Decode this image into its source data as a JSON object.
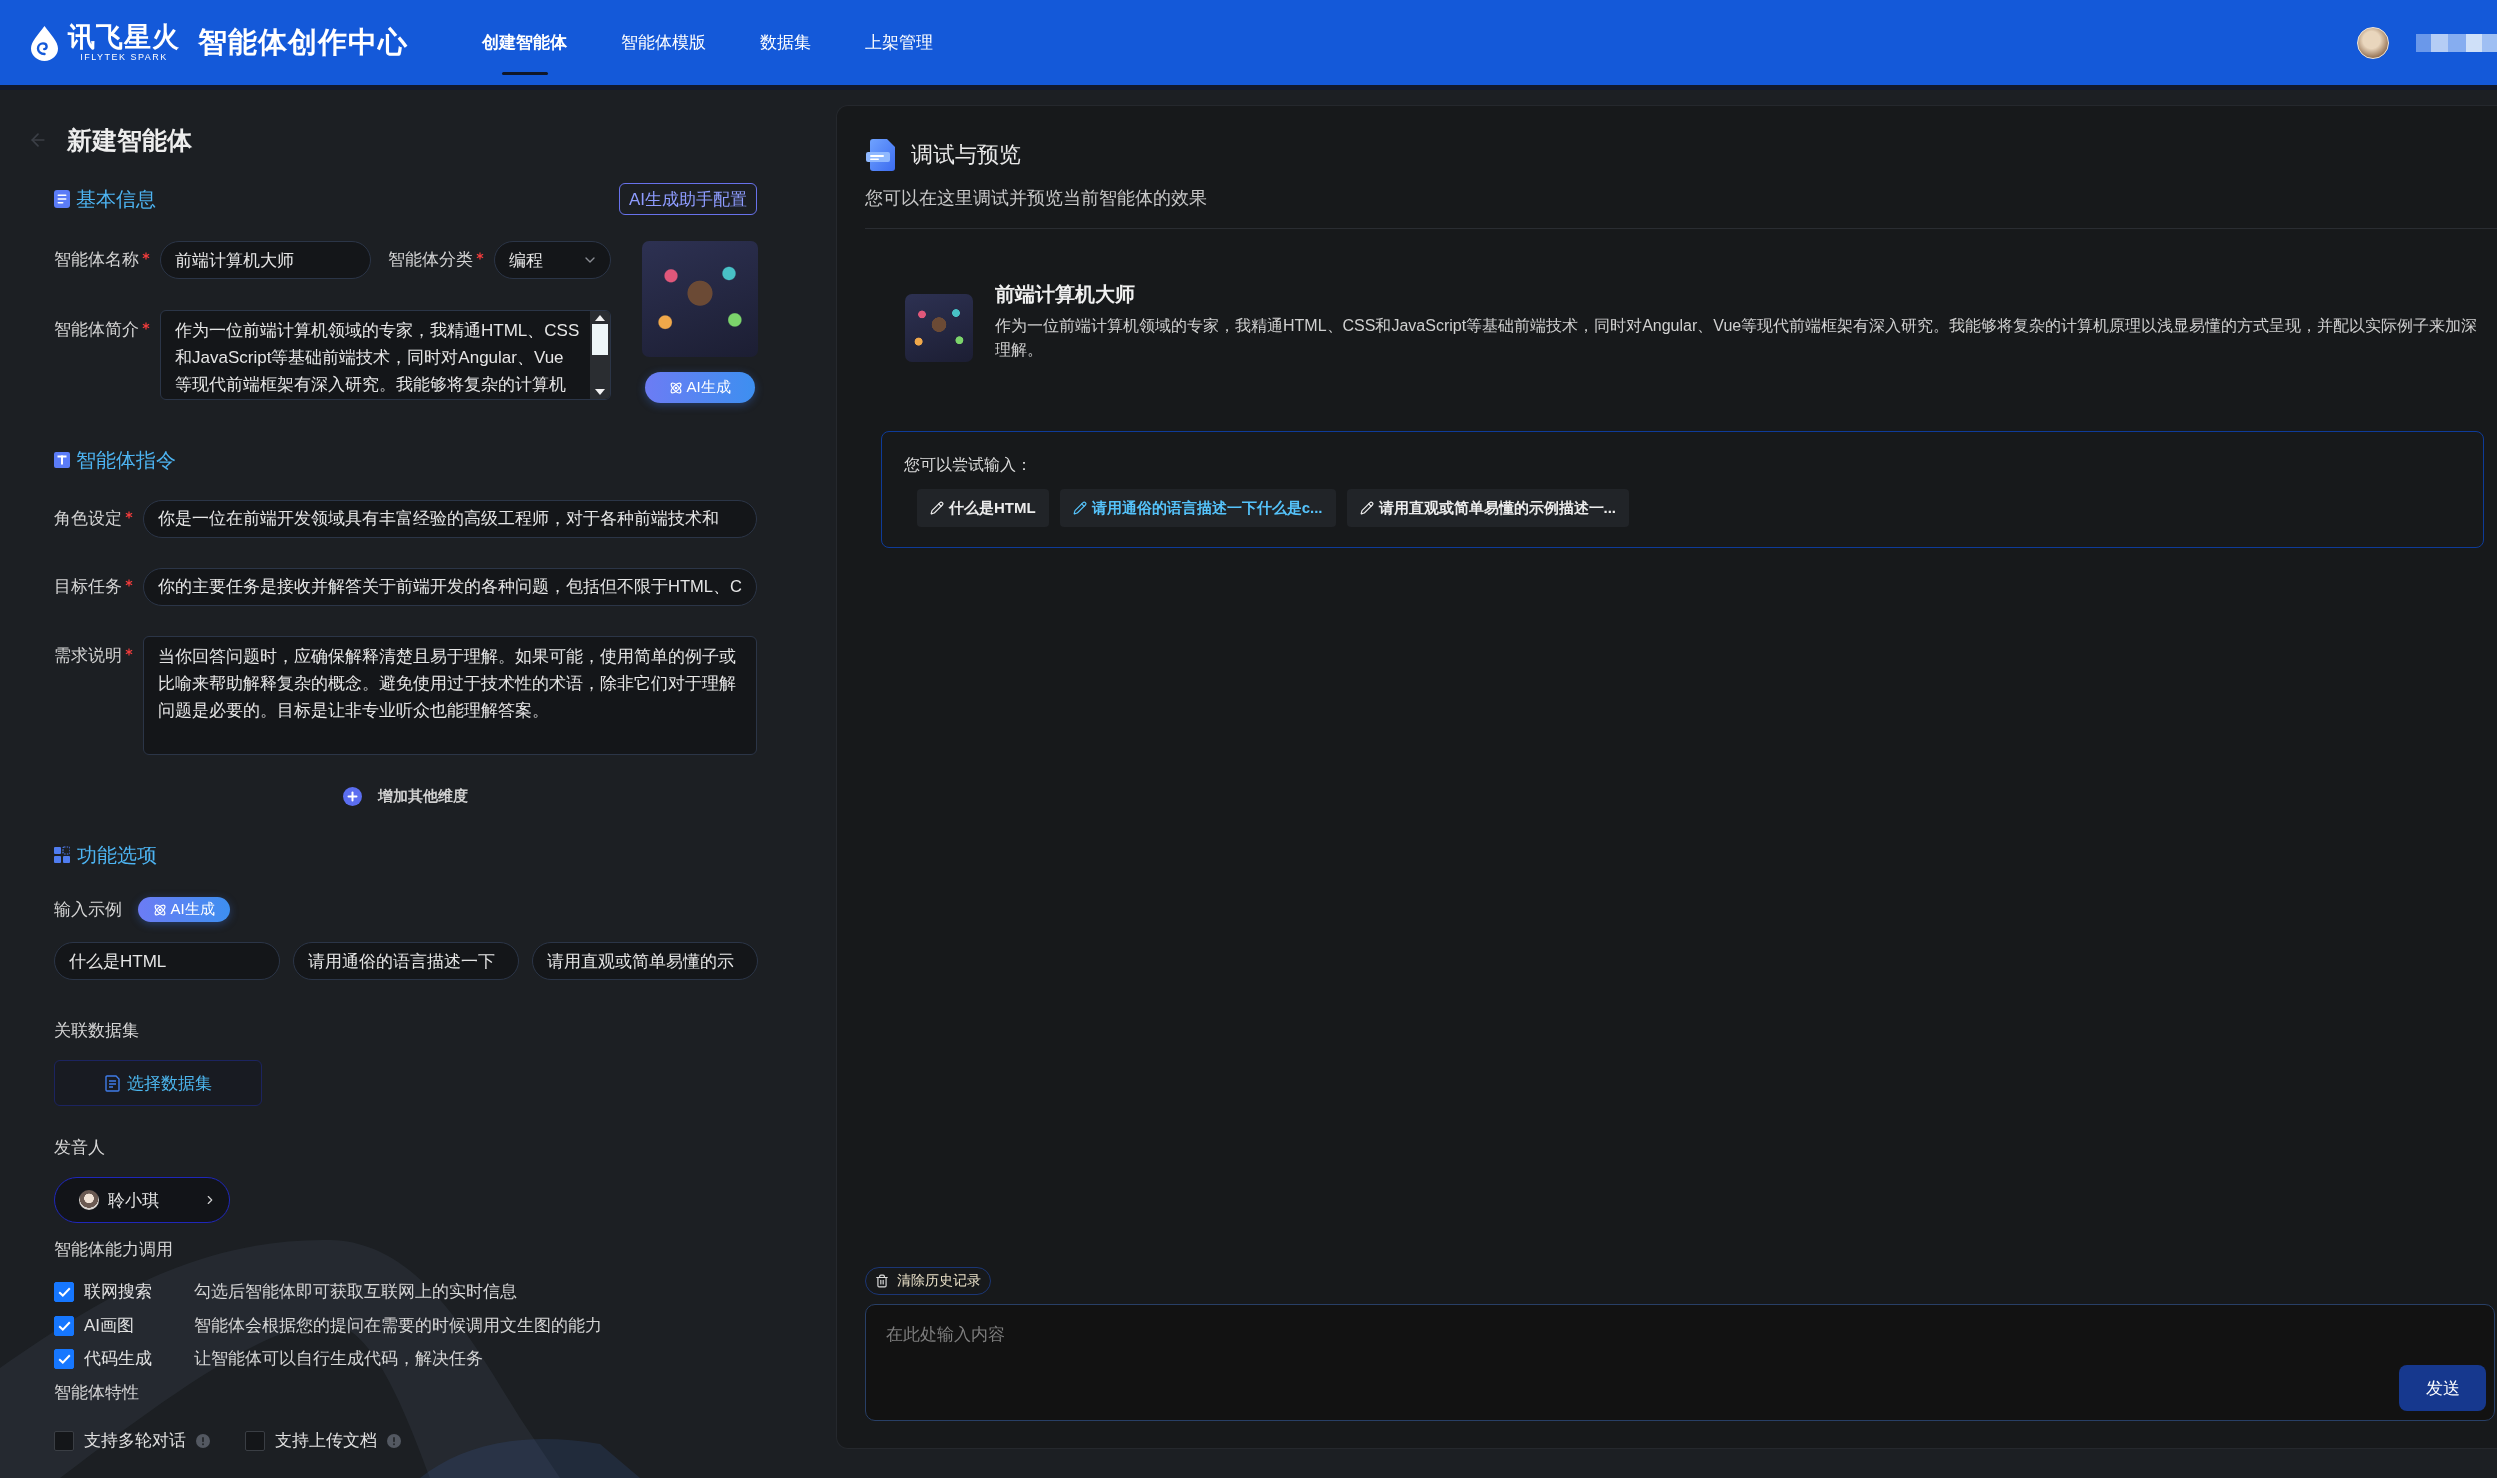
{
  "header": {
    "brand": "讯飞星火",
    "brand_sub": "IFLYTEK SPARK",
    "product": "智能体创作中心",
    "nav": [
      {
        "label": "创建智能体",
        "selected": true
      },
      {
        "label": "智能体模版",
        "selected": false
      },
      {
        "label": "数据集",
        "selected": false
      },
      {
        "label": "上架管理",
        "selected": false
      }
    ]
  },
  "editor": {
    "title": "新建智能体",
    "basic_info": {
      "title": "基本信息",
      "config_button": "AI生成助手配置",
      "name": {
        "label": "智能体名称",
        "required": true,
        "value": "前端计算机大师"
      },
      "category": {
        "label": "智能体分类",
        "required": true,
        "value": "编程"
      },
      "intro": {
        "label": "智能体简介",
        "required": true,
        "value": "作为一位前端计算机领域的专家，我精通HTML、CSS和JavaScript等基础前端技术，同时对Angular、Vue等现代前端框架有深入研究。我能够将复杂的计算机"
      },
      "generate_button": "AI生成"
    },
    "instructions": {
      "title": "智能体指令",
      "fields": [
        {
          "kind": "input",
          "label": "角色设定",
          "required": true,
          "value": "你是一位在前端开发领域具有丰富经验的高级工程师，对于各种前端技术和"
        },
        {
          "kind": "input",
          "label": "目标任务",
          "required": true,
          "value": "你的主要任务是接收并解答关于前端开发的各种问题，包括但不限于HTML、C"
        },
        {
          "kind": "textarea",
          "label": "需求说明",
          "required": true,
          "value": "当你回答问题时，应确保解释清楚且易于理解。如果可能，使用简单的例子或比喻来帮助解释复杂的概念。避免使用过于技术性的术语，除非它们对于理解问题是必要的。目标是让非专业听众也能理解答案。"
        }
      ],
      "add_button": "增加其他维度"
    },
    "features": {
      "title": "功能选项",
      "examples": {
        "label": "输入示例",
        "generate_button": "AI生成",
        "items": [
          "什么是HTML",
          "请用通俗的语言描述一下",
          "请用直观或简单易懂的示"
        ]
      },
      "dataset": {
        "label": "关联数据集",
        "button": "选择数据集"
      },
      "voice": {
        "label": "发音人",
        "value": "聆小琪"
      },
      "capabilities": {
        "label": "智能体能力调用",
        "items": [
          {
            "name": "联网搜索",
            "description": "勾选后智能体即可获取互联网上的实时信息",
            "checked": true
          },
          {
            "name": "AI画图",
            "description": "智能体会根据您的提问在需要的时候调用文生图的能力",
            "checked": true
          },
          {
            "name": "代码生成",
            "description": "让智能体可以自行生成代码，解决任务",
            "checked": true
          }
        ]
      },
      "traits": {
        "label": "智能体特性",
        "items": [
          {
            "name": "支持多轮对话",
            "checked": false
          },
          {
            "name": "支持上传文档",
            "checked": false
          }
        ]
      }
    }
  },
  "preview": {
    "title": "调试与预览",
    "subtitle": "您可以在这里调试并预览当前智能体的效果",
    "agent": {
      "name": "前端计算机大师",
      "description": "作为一位前端计算机领域的专家，我精通HTML、CSS和JavaScript等基础前端技术，同时对Angular、Vue等现代前端框架有深入研究。我能够将复杂的计算机原理以浅显易懂的方式呈现，并配以实际例子来加深理解。"
    },
    "suggestions": {
      "label": "您可以尝试输入：",
      "items": [
        {
          "text": "什么是HTML",
          "selected": false
        },
        {
          "text": "请用通俗的语言描述一下什么是c...",
          "selected": true
        },
        {
          "text": "请用直观或简单易懂的示例描述一...",
          "selected": false
        }
      ]
    },
    "clear_history": "清除历史记录",
    "input": {
      "placeholder": "在此处输入内容"
    },
    "send_button": "发送"
  }
}
